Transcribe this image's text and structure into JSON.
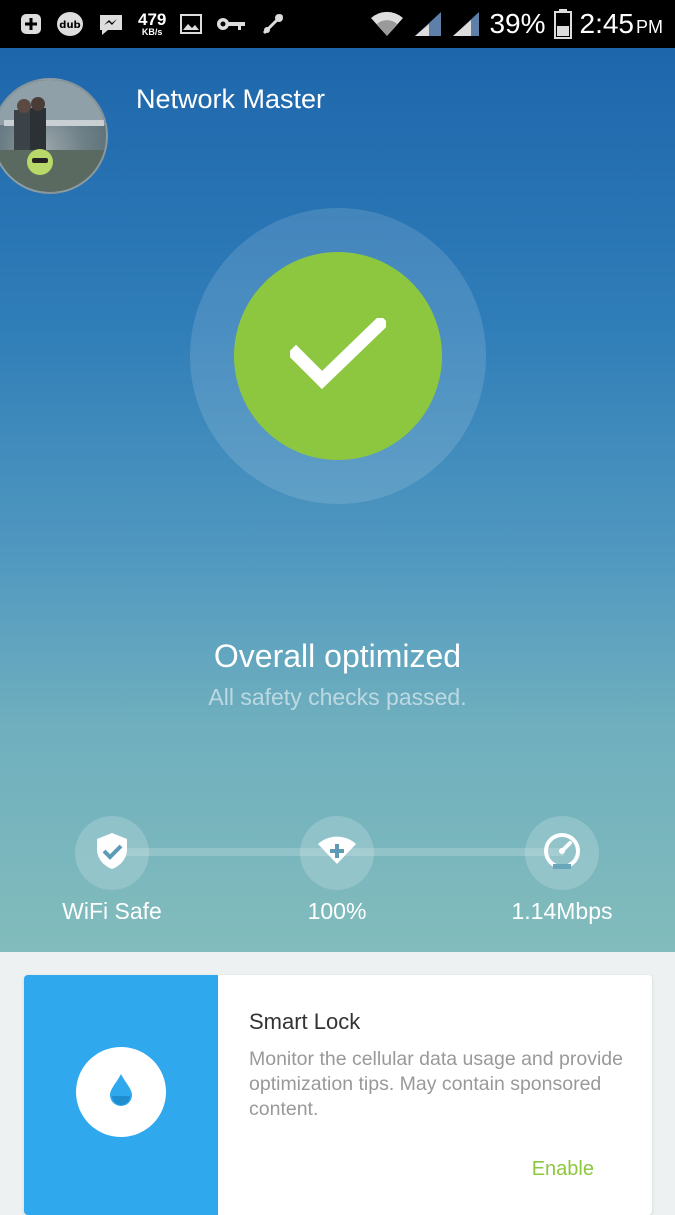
{
  "status_bar": {
    "net_speed_value": "479",
    "net_speed_unit": "KB/s",
    "battery_percent": "39%",
    "time": "2:45",
    "ampm": "PM",
    "icons": [
      "plus-app-icon",
      "dub-app-icon",
      "messenger-icon",
      "net-speed",
      "gallery-icon",
      "key-icon",
      "usb-debug-icon",
      "wifi-icon",
      "signal-icon",
      "signal-icon-2",
      "battery-icon"
    ]
  },
  "header": {
    "app_title": "Network Master"
  },
  "status": {
    "title": "Overall optimized",
    "subtitle": "All safety checks passed."
  },
  "metrics": [
    {
      "label": "WiFi Safe",
      "icon": "shield-check-icon"
    },
    {
      "label": "100%",
      "icon": "wifi-plus-icon"
    },
    {
      "label": "1.14Mbps",
      "icon": "speedometer-icon"
    }
  ],
  "card": {
    "title": "Smart Lock",
    "description": "Monitor the cellular data usage and provide optimization tips. May contain sponsored content.",
    "action": "Enable",
    "icon": "water-drop-icon"
  },
  "colors": {
    "accent_green": "#8dc63f",
    "card_blue": "#2fa8ee",
    "header_blue": "#1e66ac"
  }
}
